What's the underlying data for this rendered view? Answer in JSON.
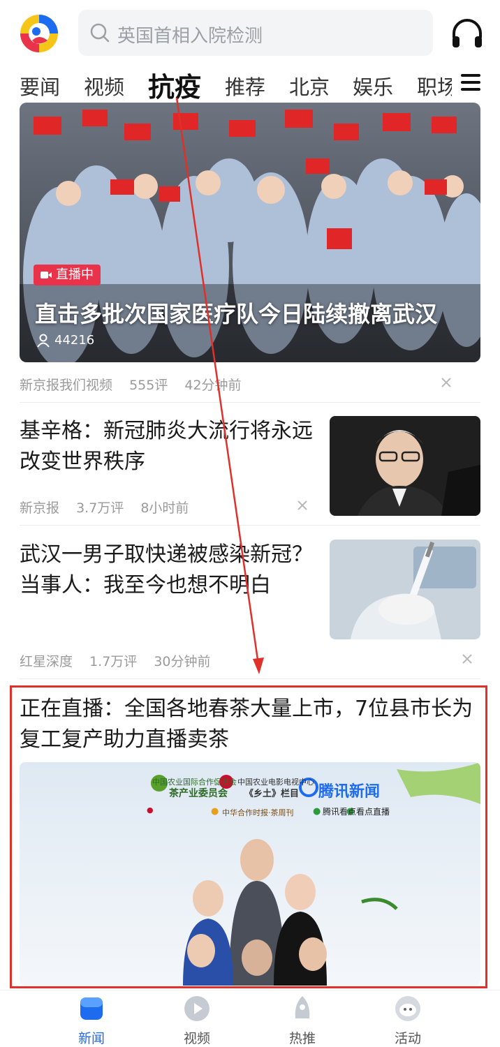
{
  "search": {
    "placeholder": "英国首相入院检测"
  },
  "tabs": [
    {
      "label": "要闻"
    },
    {
      "label": "视频"
    },
    {
      "label": "抗疫",
      "active": true
    },
    {
      "label": "推荐"
    },
    {
      "label": "北京"
    },
    {
      "label": "娱乐"
    },
    {
      "label": "职场"
    }
  ],
  "hero": {
    "badge": "直播中",
    "title": "直击多批次国家医疗队今日陆续撤离武汉",
    "views": "44216",
    "source": "新京报我们视频",
    "comments": "555评",
    "time": "42分钟前"
  },
  "articles": [
    {
      "title": "基辛格：新冠肺炎大流行将永远改变世界秩序",
      "source": "新京报",
      "comments": "3.7万评",
      "time": "8小时前"
    },
    {
      "title": "武汉一男子取快递被感染新冠？当事人：我至今也想不明白",
      "source": "红星深度",
      "comments": "1.7万评",
      "time": "30分钟前"
    }
  ],
  "highlight": {
    "title": "正在直播：全国各地春茶大量上市，7位县市长为复工复产助力直播卖茶",
    "banner": {
      "org1_line1": "中国农业国际合作促进会",
      "org1_line2": "茶产业委员会",
      "org2_line1": "中国农业电影电视中心",
      "org2_line2": "《乡土》栏目",
      "brand": "腾讯新闻",
      "sub1": "中华合作时报·茶周刊",
      "sub2": "腾讯看点",
      "sub3": "看点直播"
    }
  },
  "bottom_nav": [
    {
      "label": "新闻",
      "active": true
    },
    {
      "label": "视频"
    },
    {
      "label": "热推"
    },
    {
      "label": "活动"
    }
  ],
  "colors": {
    "accent": "#1d6cf0",
    "live_red": "#e8334a",
    "highlight_border": "#e0302a"
  }
}
